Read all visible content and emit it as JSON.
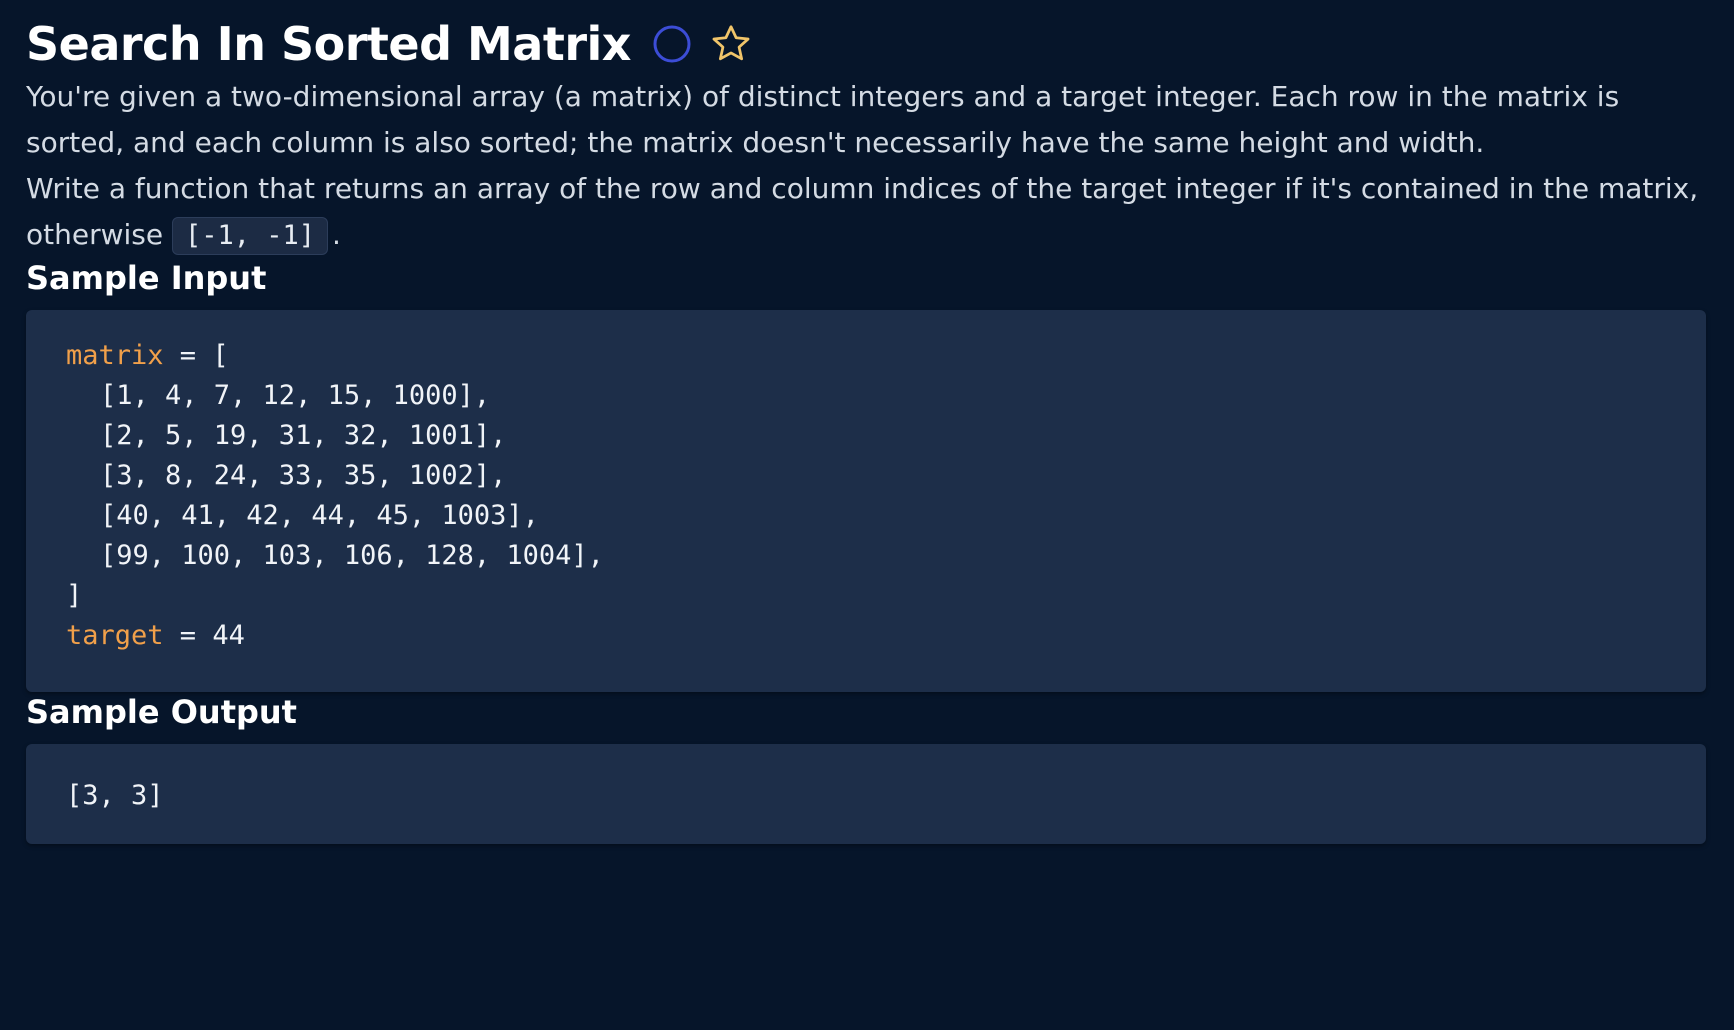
{
  "title": "Search In Sorted Matrix",
  "icons": {
    "status": "circle-icon",
    "favorite": "star-icon"
  },
  "colors": {
    "background": "#06152a",
    "code_background": "#1d2e49",
    "circle_outline": "#3c4dd6",
    "star_outline": "#f1c56a",
    "variable_name": "#f1a04a"
  },
  "description": {
    "paragraph1": "You're given a two-dimensional array (a matrix) of distinct integers and a target integer. Each row in the matrix is sorted, and each column is also sorted; the matrix doesn't necessarily have the same height and width.",
    "paragraph2": "Write a function that returns an array of the row and column indices of the target integer if it's contained in the matrix, otherwise ",
    "inline_code": "[-1, -1]",
    "paragraph2_end": "."
  },
  "sample_input": {
    "heading": "Sample Input",
    "matrix_var": "matrix",
    "matrix_open": " = [",
    "rows": [
      "[1, 4, 7, 12, 15, 1000],",
      "[2, 5, 19, 31, 32, 1001],",
      "[3, 8, 24, 33, 35, 1002],",
      "[40, 41, 42, 44, 45, 1003],",
      "[99, 100, 103, 106, 128, 1004],"
    ],
    "matrix_close": "]",
    "target_var": "target",
    "target_assign": " = 44"
  },
  "sample_output": {
    "heading": "Sample Output",
    "value": "[3, 3]"
  }
}
